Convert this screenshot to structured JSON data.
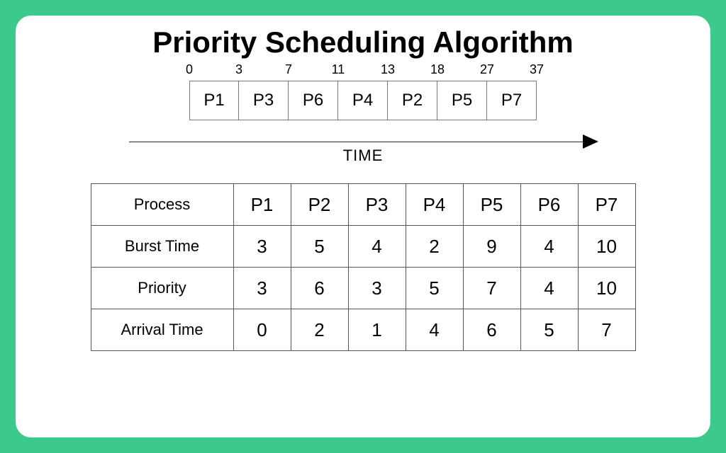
{
  "title": "Priority Scheduling Algorithm",
  "time_label": "TIME",
  "gantt": {
    "ticks": [
      "0",
      "3",
      "7",
      "11",
      "13",
      "18",
      "27",
      "37"
    ],
    "labels": [
      "P1",
      "P3",
      "P6",
      "P4",
      "P2",
      "P5",
      "P7"
    ]
  },
  "table": {
    "headers": [
      "Process",
      "Burst Time",
      "Priority",
      "Arrival Time"
    ],
    "columns": [
      "P1",
      "P2",
      "P3",
      "P4",
      "P5",
      "P6",
      "P7"
    ],
    "rows": {
      "Burst Time": [
        "3",
        "5",
        "4",
        "2",
        "9",
        "4",
        "10"
      ],
      "Priority": [
        "3",
        "6",
        "3",
        "5",
        "7",
        "4",
        "10"
      ],
      "Arrival Time": [
        "0",
        "2",
        "1",
        "4",
        "6",
        "5",
        "7"
      ]
    }
  },
  "chart_data": {
    "type": "table",
    "title": "Priority Scheduling Algorithm",
    "gantt_sequence": [
      {
        "process": "P1",
        "start": 0,
        "end": 3
      },
      {
        "process": "P3",
        "start": 3,
        "end": 7
      },
      {
        "process": "P6",
        "start": 7,
        "end": 11
      },
      {
        "process": "P4",
        "start": 11,
        "end": 13
      },
      {
        "process": "P2",
        "start": 13,
        "end": 18
      },
      {
        "process": "P5",
        "start": 18,
        "end": 27
      },
      {
        "process": "P7",
        "start": 27,
        "end": 37
      }
    ],
    "processes": [
      {
        "name": "P1",
        "burst_time": 3,
        "priority": 3,
        "arrival_time": 0
      },
      {
        "name": "P2",
        "burst_time": 5,
        "priority": 6,
        "arrival_time": 2
      },
      {
        "name": "P3",
        "burst_time": 4,
        "priority": 3,
        "arrival_time": 1
      },
      {
        "name": "P4",
        "burst_time": 2,
        "priority": 5,
        "arrival_time": 4
      },
      {
        "name": "P5",
        "burst_time": 9,
        "priority": 7,
        "arrival_time": 6
      },
      {
        "name": "P6",
        "burst_time": 4,
        "priority": 4,
        "arrival_time": 5
      },
      {
        "name": "P7",
        "burst_time": 10,
        "priority": 10,
        "arrival_time": 7
      }
    ]
  }
}
